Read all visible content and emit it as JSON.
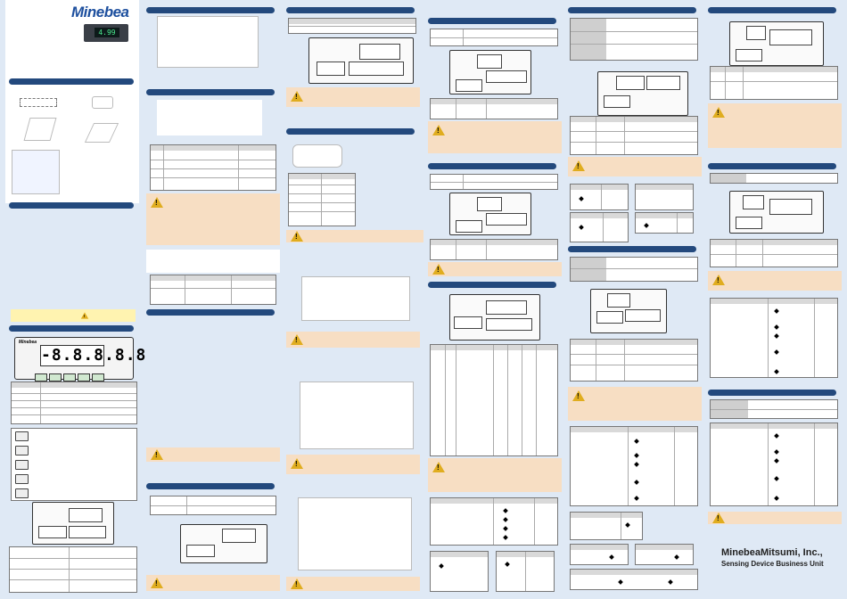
{
  "brand": {
    "logo_text": "Minebea",
    "meter_display": "4.99",
    "lcd_display": "-8.8.8.8.8",
    "lcd_brand": "Minebea"
  },
  "footer": {
    "company": "MinebeaMitsumi, Inc.,",
    "division": "Sensing Device Business Unit"
  },
  "colors": {
    "section_header": "#23497d",
    "background": "#dfe9f5",
    "caution_box": "#f7dec3",
    "caution_icon": "#e0ad1f",
    "logo": "#1d4f9e"
  },
  "icons": [
    "warning-triangle-icon",
    "bullet-diamond-icon"
  ]
}
